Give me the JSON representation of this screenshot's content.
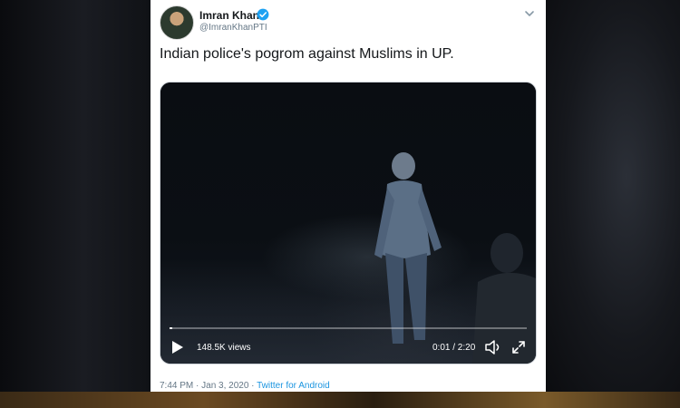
{
  "tweet": {
    "author_name": "Imran Khan",
    "author_handle": "@ImranKhanPTI",
    "text": "Indian police's pogrom against Muslims in UP.",
    "timestamp": "7:44 PM · Jan 3, 2020 · ",
    "source": "Twitter for Android",
    "verified": true
  },
  "video": {
    "views": "148.5K views",
    "time": "0:01 / 2:20",
    "progress": 0.007
  },
  "icons": {
    "verified": "verified-badge-icon",
    "more": "chevron-down-icon",
    "play": "play-icon",
    "volume": "volume-icon",
    "fullscreen": "fullscreen-icon"
  },
  "colors": {
    "link": "#1b95e0",
    "verified": "#1da1f2",
    "secondary_text": "#657786"
  }
}
